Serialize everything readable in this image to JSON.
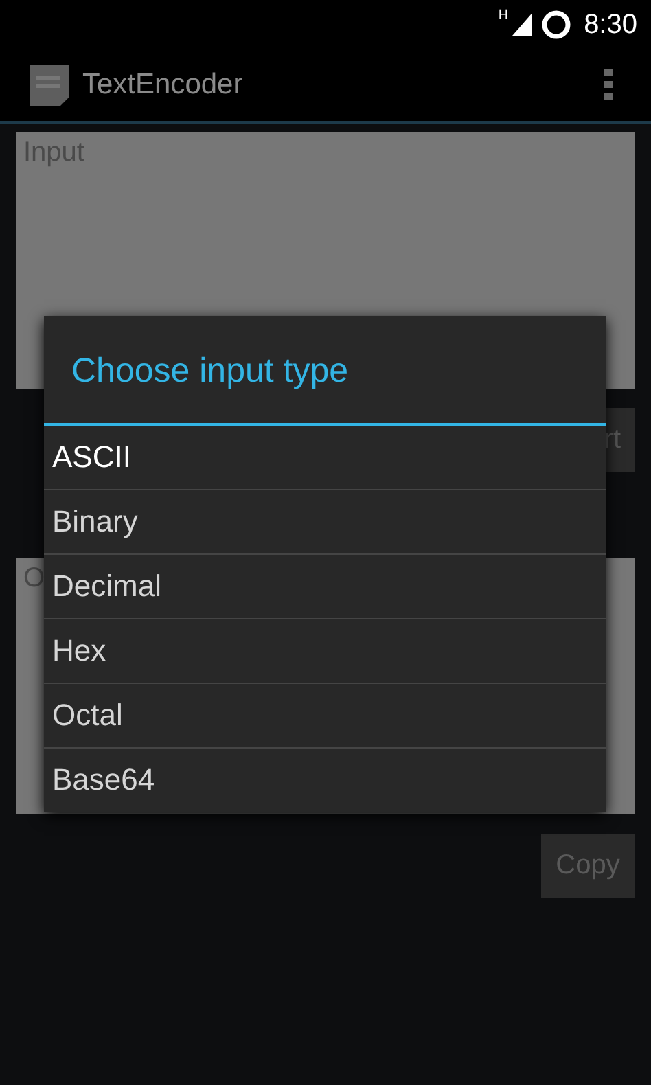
{
  "status_bar": {
    "network": "H",
    "time": "8:30"
  },
  "action_bar": {
    "title": "TextEncoder"
  },
  "input_field": {
    "placeholder": "Input"
  },
  "convert_button": {
    "label": "rt"
  },
  "output_field": {
    "placeholder": "O"
  },
  "copy_button": {
    "label": "Copy"
  },
  "dialog": {
    "title": "Choose input type",
    "options": [
      {
        "label": "ASCII",
        "selected": true
      },
      {
        "label": "Binary",
        "selected": false
      },
      {
        "label": "Decimal",
        "selected": false
      },
      {
        "label": "Hex",
        "selected": false
      },
      {
        "label": "Octal",
        "selected": false
      },
      {
        "label": "Base64",
        "selected": false
      }
    ]
  }
}
